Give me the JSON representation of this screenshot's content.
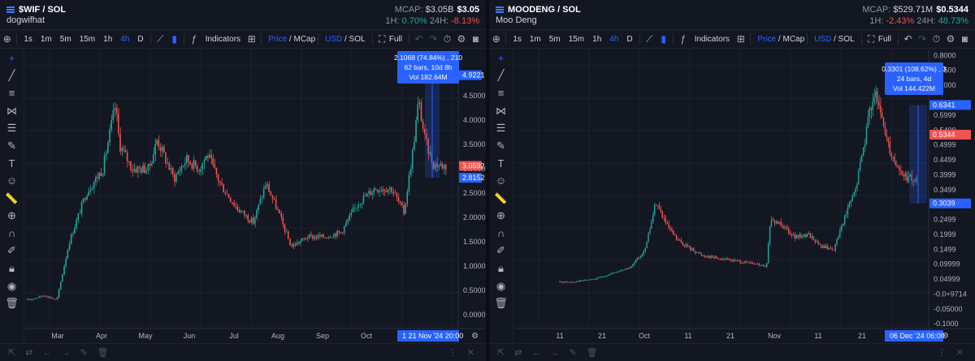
{
  "panes": [
    {
      "symbol": "$WIF / SOL",
      "name": "dogwifhat",
      "mcap_label": "MCAP:",
      "mcap_value": "$3.05B",
      "price": "$3.05",
      "h1_label": "1H:",
      "h1_change": "0.70%",
      "h24_label": "24H:",
      "h24_change": "-8.13%",
      "toolbar": {
        "intervals": [
          "1s",
          "1m",
          "5m",
          "15m",
          "1h",
          "4h",
          "D"
        ],
        "active_interval": "4h",
        "indicators": "Indicators",
        "price": "Price",
        "mcap": "MCap",
        "usd": "USD",
        "sol": "SOL",
        "full": "Full"
      },
      "y_ticks": [
        "4.5000",
        "4.0000",
        "3.5000",
        "3.0000",
        "2.5000",
        "2.0000",
        "1.5000",
        "1.0000",
        "0.5000",
        "0.0000",
        "5.0000"
      ],
      "price_labels": {
        "high": "4.9221",
        "current": "3.0592",
        "low": "2.8152"
      },
      "x_ticks": [
        "Mar",
        "Apr",
        "May",
        "Jun",
        "Jul",
        "Aug",
        "Sep",
        "Oct"
      ],
      "date_label": "21 Nov '24",
      "time_label": "20:00",
      "date_prefix": "1",
      "measure": {
        "line1": "2.1068 (74.84%) , 210",
        "line2": "62 bars, 10d 8h",
        "line3": "Vol 182.64M"
      }
    },
    {
      "symbol": "MOODENG / SOL",
      "name": "Moo Deng",
      "mcap_label": "MCAP:",
      "mcap_value": "$529.71M",
      "price": "$0.5344",
      "h1_label": "1H:",
      "h1_change": "-2.43%",
      "h24_label": "24H:",
      "h24_change": "48.73%",
      "toolbar": {
        "intervals": [
          "1s",
          "1m",
          "5m",
          "15m",
          "1h",
          "4h",
          "D"
        ],
        "active_interval": "4h",
        "indicators": "Indicators",
        "price": "Price",
        "mcap": "MCap",
        "usd": "USD",
        "sol": "SOL",
        "full": "Full"
      },
      "y_ticks": [
        "0.8000",
        "0.7500",
        "0.7000",
        "0.5999",
        "0.5499",
        "0.4999",
        "0.4499",
        "0.3999",
        "0.3499",
        "0.2499",
        "0.1999",
        "0.1499",
        "0.09999",
        "0.04999",
        "-0.0+9714",
        "-0.05000",
        "-0.1000"
      ],
      "price_labels": {
        "high": "0.6341",
        "current": "0.5344",
        "low": "0.3039"
      },
      "x_ticks": [
        "11",
        "21",
        "Oct",
        "11",
        "21",
        "Nov",
        "11",
        "21"
      ],
      "date_label": "06 Dec '24",
      "time_label": "06:00",
      "measure": {
        "line1": "0.3301 (108.62%) , 3",
        "line2": "24 bars, 4d",
        "line3": "Vol 144.422M"
      }
    }
  ],
  "colors": {
    "up": "#26a69a",
    "down": "#ef5350",
    "accent": "#2962ff",
    "bg": "#131722"
  }
}
